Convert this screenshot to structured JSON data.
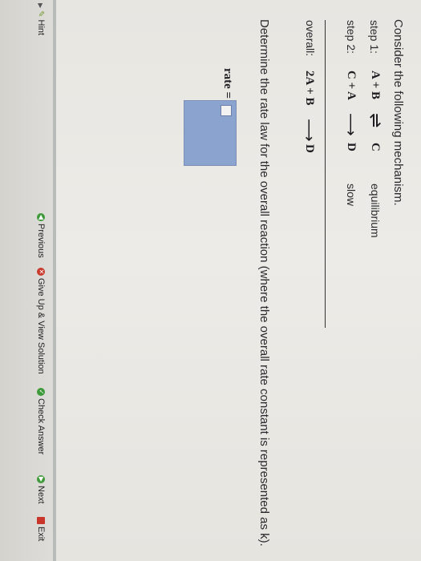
{
  "intro": "Consider the following mechanism.",
  "steps": [
    {
      "label": "step 1:",
      "reactants": "A + B",
      "arrow": "⇌",
      "product": "C",
      "note": "equilibrium"
    },
    {
      "label": "step 2:",
      "reactants": "C + A",
      "arrow": "⟶",
      "product": "D",
      "note": "slow"
    }
  ],
  "overall": {
    "label": "overall:",
    "reactants": "2A + B",
    "arrow": "⟶",
    "product": "D"
  },
  "prompt": "Determine the rate law for the overall reaction (where the overall rate constant is represented as k).",
  "answer": {
    "label": "rate =",
    "value": ""
  },
  "toolbar": {
    "hint": "Hint",
    "previous": "Previous",
    "give_up": "Give Up & View Solution",
    "check": "Check Answer",
    "next": "Next",
    "exit": "Exit"
  },
  "colors": {
    "answer_box": "#8aa4cf",
    "previous_icon": "#3e9a3a",
    "give_up_icon": "#c93a2c",
    "check_icon": "#3e9a3a",
    "next_icon": "#3e9a3a",
    "exit_icon": "#c9352b"
  }
}
